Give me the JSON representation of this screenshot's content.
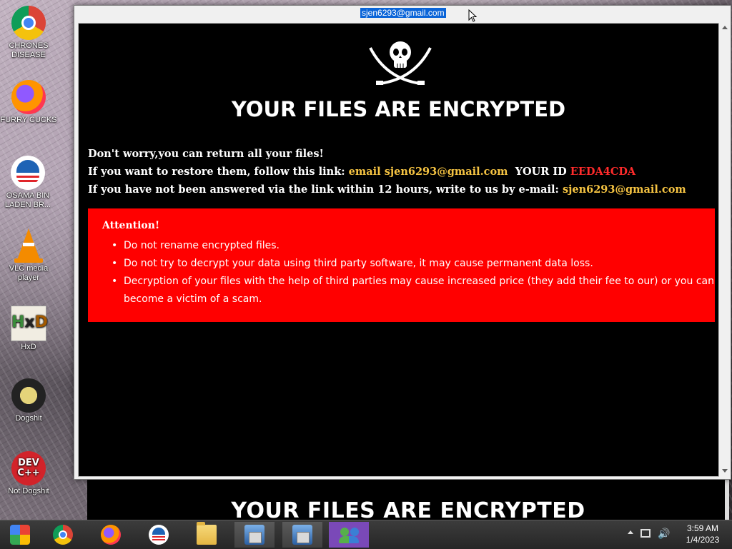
{
  "desktop": {
    "icons": [
      {
        "label": "CHRONES DISEASE"
      },
      {
        "label": "FURRY CUCKS"
      },
      {
        "label": "OSAMA BIN LADEN BR..."
      },
      {
        "label": "VLC media player"
      },
      {
        "label": "HxD"
      },
      {
        "label": "Dogshit"
      },
      {
        "label": "Not Dogshit"
      }
    ],
    "hxd_glyph": {
      "h": "H",
      "x": "x",
      "d": "D"
    },
    "dev_glyph": {
      "line1": "DEV",
      "line2": "C++"
    }
  },
  "ransom_window": {
    "title": "sjen6293@gmail.com",
    "headline": "YOUR FILES ARE ENCRYPTED",
    "line1": "Don't worry,you can return all your files!",
    "line2_prefix": "If you want to restore them, follow this link:",
    "line2_link": "email sjen6293@gmail.com",
    "line2_id_label": "YOUR ID",
    "line2_id_value": "EEDA4CDA",
    "line3_prefix": "If you have not been answered via the link within 12 hours, write to us by e-mail:",
    "line3_email": "sjen6293@gmail.com",
    "attention": {
      "title": "Attention!",
      "items": [
        "Do not rename encrypted files.",
        "Do not try to decrypt your data using third party software, it may cause permanent data loss.",
        "Decryption of your files with the help of third parties may cause increased price (they add their fee to our) or you can become a victim of a scam."
      ]
    },
    "colors": {
      "background": "#000000",
      "attention_bg": "#ff0000",
      "link": "#f5c342",
      "id": "#ff2b2b"
    }
  },
  "background_window": {
    "headline": "YOUR FILES ARE ENCRYPTED"
  },
  "taskbar": {
    "items": [
      {
        "icon": "multicolor-app-icon"
      },
      {
        "icon": "chrome-icon"
      },
      {
        "icon": "firefox-icon"
      },
      {
        "icon": "obama-logo-icon"
      },
      {
        "icon": "file-explorer-icon"
      },
      {
        "icon": "installer-icon"
      },
      {
        "icon": "installer-icon"
      },
      {
        "icon": "people-icon"
      }
    ],
    "clock": {
      "time": "3:59 AM",
      "date": "1/4/2023"
    }
  }
}
